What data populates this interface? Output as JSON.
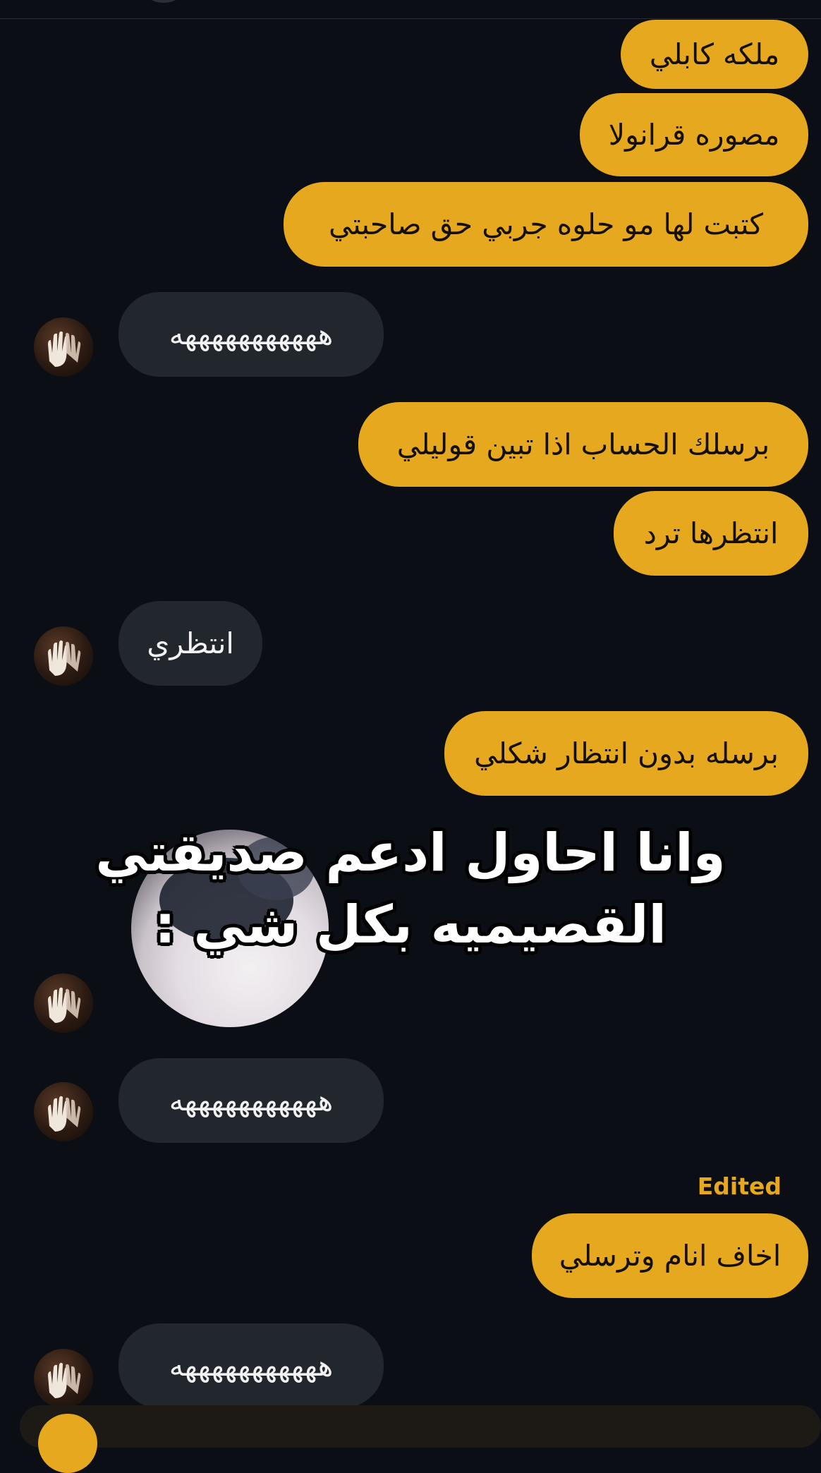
{
  "messages": [
    {
      "text": "ملكه كابلي",
      "dir": "out"
    },
    {
      "text": "مصوره قرانولا",
      "dir": "out"
    },
    {
      "text": "كتبت لها مو حلوه جربي حق صاحبتي",
      "dir": "out"
    },
    {
      "text": "هههههههههههه",
      "dir": "in"
    },
    {
      "text": "برسلك الحساب اذا تبين قوليلي",
      "dir": "out"
    },
    {
      "text": "انتظرها ترد",
      "dir": "out"
    },
    {
      "text": "انتظري",
      "dir": "in"
    },
    {
      "text": "برسله بدون انتظار شكلي",
      "dir": "out"
    },
    {
      "text": "هههههههههههه",
      "dir": "in"
    },
    {
      "text": "اخاف انام وترسلي",
      "dir": "out"
    },
    {
      "text": "هههههههههههه",
      "dir": "in"
    }
  ],
  "overlay_caption": {
    "line1": "وانا احاول ادعم صديقتي",
    "line2": "القصيميه بكل شي :"
  },
  "edited_label": "Edited",
  "colors": {
    "background": "#0b0f15",
    "outgoing_bubble": "#e5a81e",
    "incoming_bubble": "#22262d",
    "accent": "#e5a81e"
  },
  "icons": {
    "avatar": "raised-hands-avatar",
    "sticker": "round-video-sticker"
  }
}
